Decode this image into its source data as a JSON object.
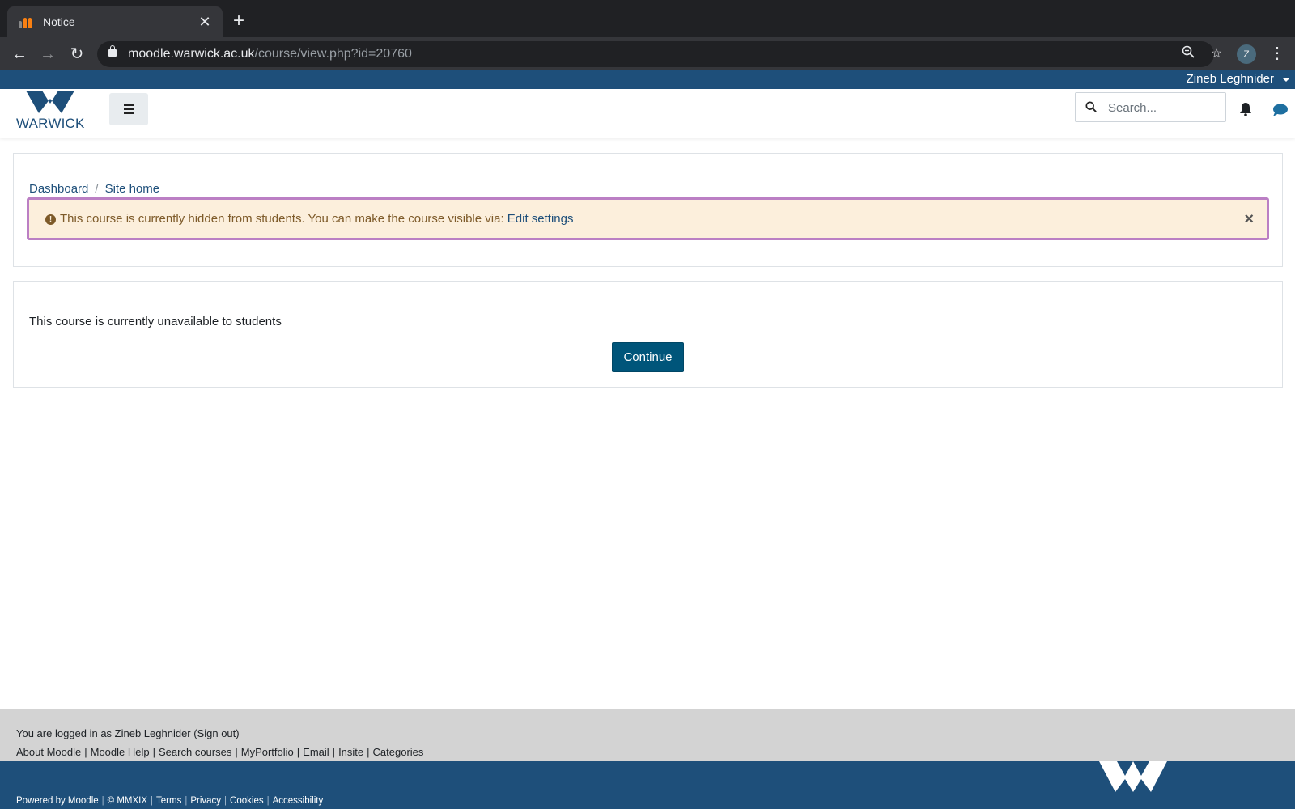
{
  "browser": {
    "tab_title": "Notice",
    "url_host": "moodle.warwick.ac.uk",
    "url_path": "/course/view.php?id=20760",
    "profile_initial": "Z"
  },
  "header": {
    "user_name": "Zineb Leghnider",
    "logo_text": "WARWICK",
    "search_placeholder": "Search..."
  },
  "breadcrumb": {
    "items": [
      "Dashboard",
      "Site home"
    ],
    "separator": "/"
  },
  "alert": {
    "message": "This course is currently hidden from students. You can make the course visible via: ",
    "link_label": "Edit settings",
    "close_label": "×"
  },
  "notice": {
    "message": "This course is currently unavailable to students",
    "button_label": "Continue"
  },
  "footer": {
    "login_text": "You are logged in as Zineb Leghnider (Sign out)",
    "links": [
      "About Moodle",
      "Moodle Help",
      "Search courses",
      "MyPortfolio",
      "Email",
      "Insite",
      "Categories"
    ],
    "bottom_links": [
      "Powered by Moodle",
      "© MMXIX",
      "Terms",
      "Privacy",
      "Cookies",
      "Accessibility"
    ]
  },
  "colors": {
    "brand_blue": "#1e4f7a",
    "button_blue": "#00557a",
    "alert_bg": "#fcefdc",
    "alert_border": "#bb7fc4"
  }
}
